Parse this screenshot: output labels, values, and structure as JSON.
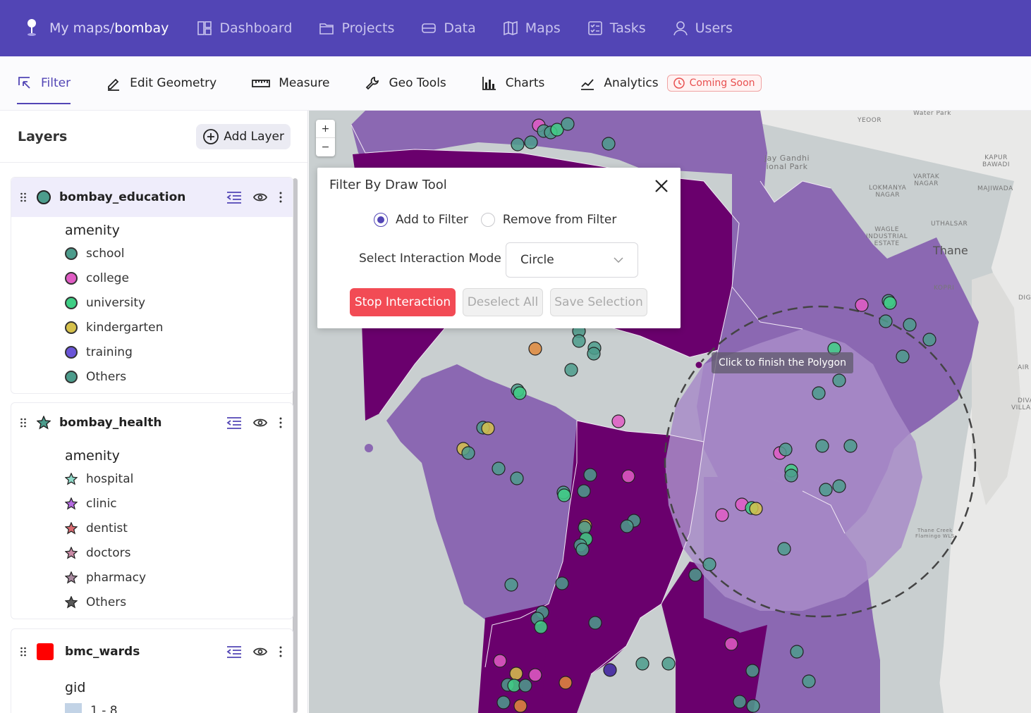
{
  "topnav": {
    "breadcrumb_root": "My maps/",
    "breadcrumb_current": "bombay",
    "items": [
      {
        "label": "Dashboard",
        "icon": "dashboard-icon"
      },
      {
        "label": "Projects",
        "icon": "folder-icon"
      },
      {
        "label": "Data",
        "icon": "database-icon"
      },
      {
        "label": "Maps",
        "icon": "map-icon"
      },
      {
        "label": "Tasks",
        "icon": "checklist-icon"
      },
      {
        "label": "Users",
        "icon": "user-icon"
      }
    ]
  },
  "toolbar": {
    "tools": [
      {
        "label": "Filter",
        "active": true
      },
      {
        "label": "Edit Geometry"
      },
      {
        "label": "Measure"
      },
      {
        "label": "Geo Tools"
      },
      {
        "label": "Charts"
      },
      {
        "label": "Analytics"
      }
    ],
    "badge": "Coming Soon"
  },
  "sidebar": {
    "title": "Layers",
    "add_layer": "Add Layer",
    "layers": [
      {
        "name": "bombay_education",
        "attribute": "amenity",
        "items": [
          {
            "label": "school",
            "color": "#4c9c8c"
          },
          {
            "label": "college",
            "color": "#e05cc4"
          },
          {
            "label": "university",
            "color": "#3fcf85"
          },
          {
            "label": "kindergarten",
            "color": "#d6c14b"
          },
          {
            "label": "training",
            "color": "#6a55d8"
          },
          {
            "label": "Others",
            "color": "#4c9c8c"
          }
        ]
      },
      {
        "name": "bombay_health",
        "attribute": "amenity",
        "items": [
          {
            "label": "hospital",
            "color": "#4c9c8c"
          },
          {
            "label": "clinic",
            "color": "#b46be0"
          },
          {
            "label": "dentist",
            "color": "#d96a70"
          },
          {
            "label": "doctors",
            "color": "#c98aa6"
          },
          {
            "label": "pharmacy",
            "color": "#a98aa0"
          },
          {
            "label": "Others",
            "color": "#5a5a5a"
          }
        ]
      },
      {
        "name": "bmc_wards",
        "attribute": "gid",
        "swatch": "#ff0000",
        "items": [
          {
            "label": "1 - 8",
            "color": "#c2d3e6"
          }
        ]
      }
    ]
  },
  "map": {
    "zoom_in": "+",
    "zoom_out": "−",
    "tooltip": "Click to finish the Polygon",
    "labels": {
      "thane": "Thane",
      "yeoor": "YEOOR",
      "park": "jay Gandhi\nional Park",
      "vartak": "VARTAK\nNAGAR",
      "lokmanya": "LOKMANYA\nNAGAR",
      "majiwada": "MAJIWADA",
      "kapur": "KAPUR\nBAWADI",
      "wagle": "WAGLE\nINDUSTRIAL\nESTATE",
      "uthalsar": "UTHALSAR",
      "kopri": "KOPRI",
      "diva": "DIVA\nVILLAGE",
      "flamingo": "Thane Creek\nFlamingo WLS",
      "waterpark": "Water Park",
      "digha": "DIG",
      "airoli": "AIR"
    }
  },
  "dialog": {
    "title": "Filter By Draw Tool",
    "add_to_filter": "Add to Filter",
    "remove_from_filter": "Remove from Filter",
    "mode_label": "Select Interaction Mode",
    "mode_value": "Circle",
    "stop": "Stop Interaction",
    "deselect": "Deselect All",
    "save": "Save Selection"
  }
}
